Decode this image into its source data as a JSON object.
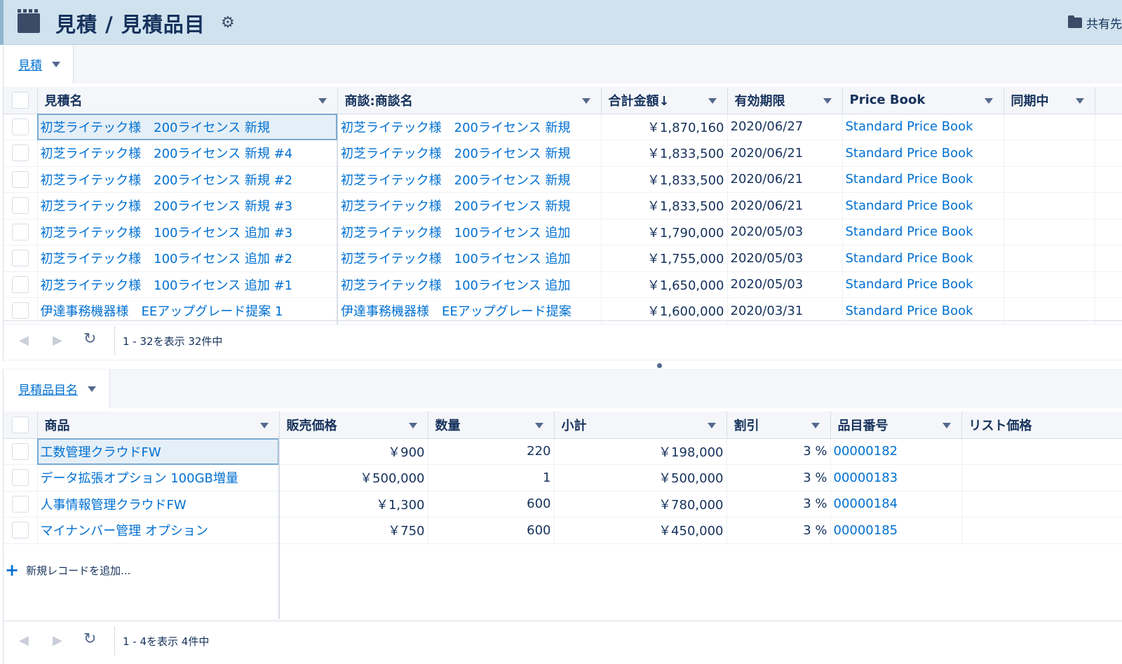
{
  "header": {
    "title": "見積 / 見積品目",
    "share_label": "共有先"
  },
  "panel1": {
    "tab_label": "見積",
    "columns": [
      "見積名",
      "商談:商談名",
      "合計金額↓",
      "有効期限",
      "Price Book",
      "同期中"
    ],
    "rows": [
      [
        "初芝ライテック様　200ライセンス 新規",
        "初芝ライテック様　200ライセンス 新規",
        "￥1,870,160",
        "2020/06/27",
        "Standard Price Book",
        ""
      ],
      [
        "初芝ライテック様　200ライセンス 新規 #4",
        "初芝ライテック様　200ライセンス 新規",
        "￥1,833,500",
        "2020/06/21",
        "Standard Price Book",
        ""
      ],
      [
        "初芝ライテック様　200ライセンス 新規 #2",
        "初芝ライテック様　200ライセンス 新規",
        "￥1,833,500",
        "2020/06/21",
        "Standard Price Book",
        ""
      ],
      [
        "初芝ライテック様　200ライセンス 新規 #3",
        "初芝ライテック様　200ライセンス 新規",
        "￥1,833,500",
        "2020/06/21",
        "Standard Price Book",
        ""
      ],
      [
        "初芝ライテック様　100ライセンス 追加 #3",
        "初芝ライテック様　100ライセンス 追加",
        "￥1,790,000",
        "2020/05/03",
        "Standard Price Book",
        ""
      ],
      [
        "初芝ライテック様　100ライセンス 追加 #2",
        "初芝ライテック様　100ライセンス 追加",
        "￥1,755,000",
        "2020/05/03",
        "Standard Price Book",
        ""
      ],
      [
        "初芝ライテック様　100ライセンス 追加 #1",
        "初芝ライテック様　100ライセンス 追加",
        "￥1,650,000",
        "2020/05/03",
        "Standard Price Book",
        ""
      ],
      [
        "伊達事務機器様　EEアップグレード提案 1",
        "伊達事務機器様　EEアップグレード提案",
        "￥1,600,000",
        "2020/03/31",
        "Standard Price Book",
        ""
      ]
    ],
    "pager_text": "1 - 32を表示 32件中"
  },
  "panel2": {
    "tab_label": "見積品目名",
    "columns": [
      "商品",
      "販売価格",
      "数量",
      "小計",
      "割引",
      "品目番号",
      "リスト価格"
    ],
    "rows": [
      [
        "工数管理クラウドFW",
        "￥900",
        "220",
        "￥198,000",
        "3 %",
        "00000182",
        ""
      ],
      [
        "データ拡張オプション 100GB増量",
        "￥500,000",
        "1",
        "￥500,000",
        "3 %",
        "00000183",
        ""
      ],
      [
        "人事情報管理クラウドFW",
        "￥1,300",
        "600",
        "￥780,000",
        "3 %",
        "00000184",
        ""
      ],
      [
        "マイナンバー管理 オプション",
        "￥750",
        "600",
        "￥450,000",
        "3 %",
        "00000185",
        ""
      ]
    ],
    "add_record_label": "新規レコードを追加...",
    "pager_text": "1 - 4を表示 4件中"
  },
  "icons": {
    "app": "quote-app-icon",
    "settings": "gear-icon",
    "share": "folder-icon",
    "refresh": "refresh-icon"
  }
}
